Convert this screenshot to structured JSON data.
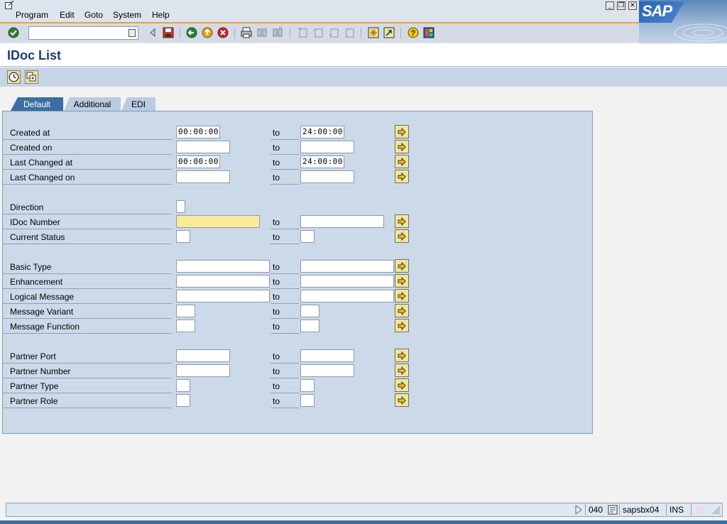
{
  "menu": {
    "items": [
      {
        "label": "Program"
      },
      {
        "label": "Edit"
      },
      {
        "label": "Goto"
      },
      {
        "label": "System"
      },
      {
        "label": "Help"
      }
    ],
    "logo_text": "SAP"
  },
  "toolbar": {
    "command_field_value": ""
  },
  "page": {
    "title": "IDoc List"
  },
  "tabs": [
    {
      "label": "Default",
      "active": true
    },
    {
      "label": "Additional",
      "active": false
    },
    {
      "label": "EDI",
      "active": false
    }
  ],
  "fields": {
    "to_label": "to",
    "created_at": {
      "label": "Created at",
      "from": "00:00:00",
      "to": "24:00:00"
    },
    "created_on": {
      "label": "Created on",
      "from": "",
      "to": ""
    },
    "last_changed_at": {
      "label": "Last Changed at",
      "from": "00:00:00",
      "to": "24:00:00"
    },
    "last_changed_on": {
      "label": "Last Changed on",
      "from": "",
      "to": ""
    },
    "direction": {
      "label": "Direction",
      "value": ""
    },
    "idoc_number": {
      "label": "IDoc Number",
      "from": "",
      "to": ""
    },
    "current_status": {
      "label": "Current Status",
      "from": "",
      "to": ""
    },
    "basic_type": {
      "label": "Basic Type",
      "from": "",
      "to": ""
    },
    "enhancement": {
      "label": "Enhancement",
      "from": "",
      "to": ""
    },
    "logical_message": {
      "label": "Logical Message",
      "from": "",
      "to": ""
    },
    "message_variant": {
      "label": "Message Variant",
      "from": "",
      "to": ""
    },
    "message_function": {
      "label": "Message Function",
      "from": "",
      "to": ""
    },
    "partner_port": {
      "label": "Partner Port",
      "from": "",
      "to": ""
    },
    "partner_number": {
      "label": "Partner Number",
      "from": "",
      "to": ""
    },
    "partner_type": {
      "label": "Partner Type",
      "from": "",
      "to": ""
    },
    "partner_role": {
      "label": "Partner Role",
      "from": "",
      "to": ""
    }
  },
  "status": {
    "client": "040",
    "server": "sapsbx04",
    "mode": "INS"
  },
  "colors": {
    "required_field": "#fbe99a",
    "active_tab": "#3d6ea3",
    "panel": "#ccd9e8"
  }
}
